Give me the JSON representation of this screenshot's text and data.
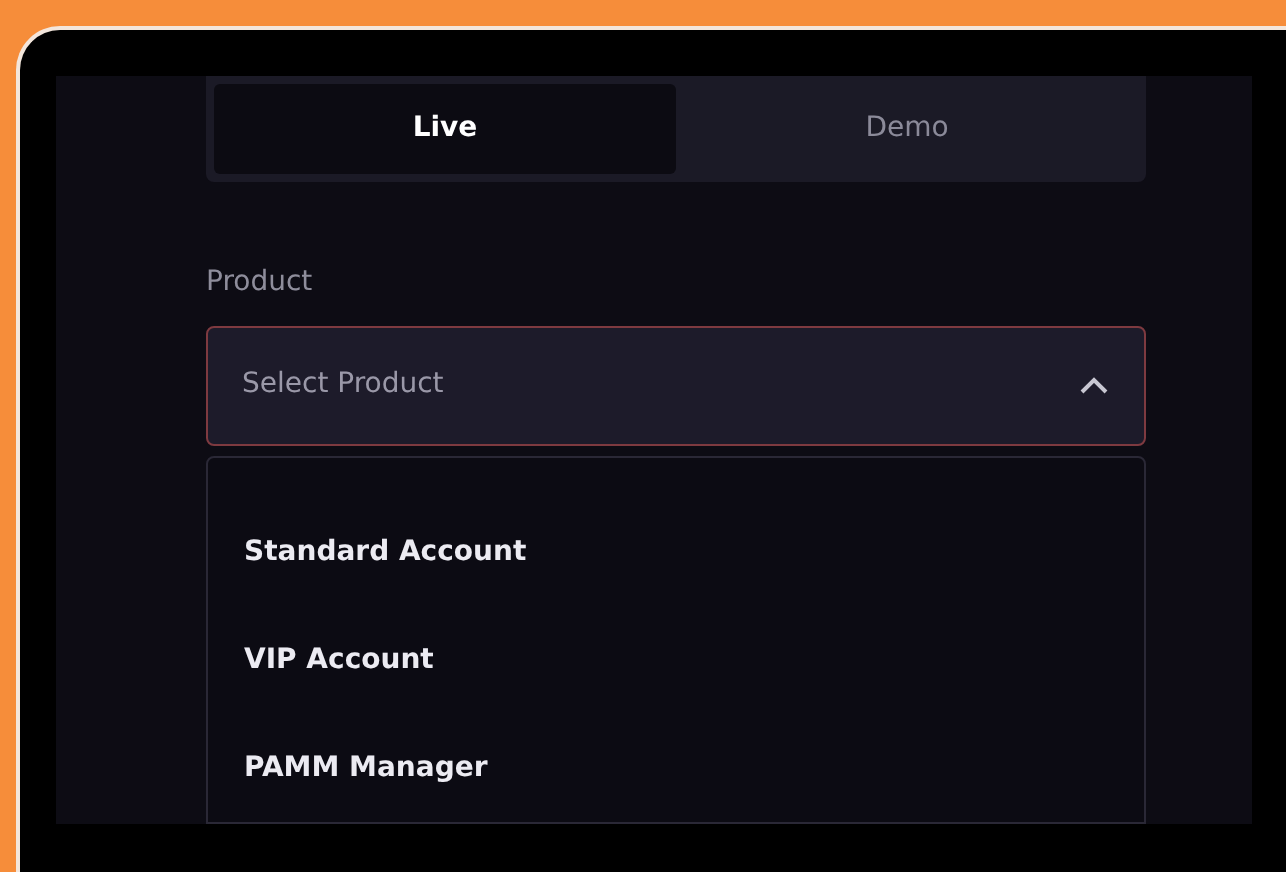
{
  "tabs": [
    {
      "label": "Live",
      "selected": true
    },
    {
      "label": "Demo",
      "selected": false
    }
  ],
  "product": {
    "label": "Product",
    "placeholder": "Select Product",
    "expanded": true
  },
  "options": [
    "Standard Account",
    "VIP Account",
    "PAMM Manager"
  ]
}
